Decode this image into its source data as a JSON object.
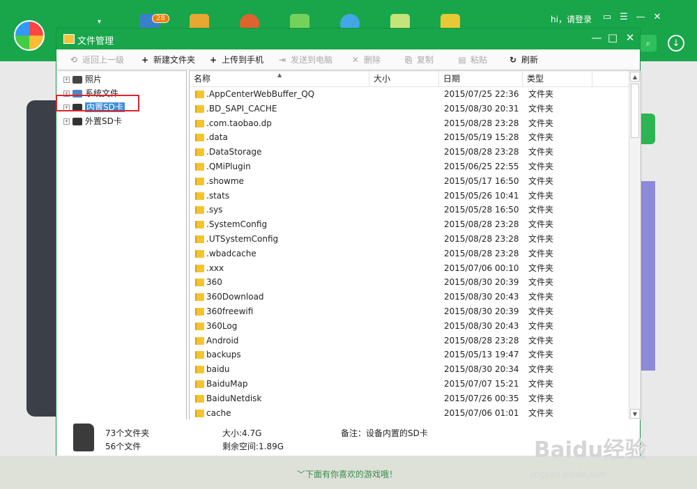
{
  "header": {
    "badge": "28",
    "greeting": "hi，请登录",
    "drop_glyph": "▾",
    "icons": [
      "chat-icon",
      "list-icon",
      "minimize-icon",
      "close-icon"
    ]
  },
  "window": {
    "title": "文件管理",
    "controls": {
      "minimize": "—",
      "maximize": "□",
      "close": "✕"
    }
  },
  "toolbar": [
    {
      "label": "返回上一级",
      "icon": "⟲",
      "disabled": true
    },
    {
      "label": "新建文件夹",
      "icon": "+",
      "disabled": false
    },
    {
      "label": "上传到手机",
      "icon": "+",
      "disabled": false
    },
    {
      "label": "发送到电脑",
      "icon": "⇥",
      "disabled": true
    },
    {
      "label": "删除",
      "icon": "✕",
      "disabled": true
    },
    {
      "label": "复制",
      "icon": "⎘",
      "disabled": true
    },
    {
      "label": "粘贴",
      "icon": "▤",
      "disabled": true
    },
    {
      "label": "刷新",
      "icon": "↻",
      "disabled": false
    }
  ],
  "tree": [
    {
      "label": "照片",
      "icon": "camera-icon"
    },
    {
      "label": "系统文件",
      "icon": "phone-icon"
    },
    {
      "label": "内置SD卡",
      "icon": "sd-card-icon",
      "selected": true
    },
    {
      "label": "外置SD卡",
      "icon": "sd-card-icon"
    }
  ],
  "columns": {
    "name": "名称",
    "size": "大小",
    "date": "日期",
    "type": "类型"
  },
  "files": [
    {
      "name": ".AppCenterWebBuffer_QQ",
      "date": "2015/07/25 22:36",
      "type": "文件夹"
    },
    {
      "name": ".BD_SAPI_CACHE",
      "date": "2015/08/30 20:31",
      "type": "文件夹"
    },
    {
      "name": ".com.taobao.dp",
      "date": "2015/08/28 23:28",
      "type": "文件夹"
    },
    {
      "name": ".data",
      "date": "2015/05/19 15:28",
      "type": "文件夹"
    },
    {
      "name": ".DataStorage",
      "date": "2015/08/28 23:28",
      "type": "文件夹"
    },
    {
      "name": ".QMiPlugin",
      "date": "2015/06/25 22:55",
      "type": "文件夹"
    },
    {
      "name": ".showme",
      "date": "2015/05/17 16:50",
      "type": "文件夹"
    },
    {
      "name": ".stats",
      "date": "2015/05/26 10:41",
      "type": "文件夹"
    },
    {
      "name": ".sys",
      "date": "2015/05/28 16:50",
      "type": "文件夹"
    },
    {
      "name": ".SystemConfig",
      "date": "2015/08/28 23:28",
      "type": "文件夹"
    },
    {
      "name": ".UTSystemConfig",
      "date": "2015/08/28 23:28",
      "type": "文件夹"
    },
    {
      "name": ".wbadcache",
      "date": "2015/08/28 23:28",
      "type": "文件夹"
    },
    {
      "name": ".xxx",
      "date": "2015/07/06 00:10",
      "type": "文件夹"
    },
    {
      "name": "360",
      "date": "2015/08/30 20:39",
      "type": "文件夹"
    },
    {
      "name": "360Download",
      "date": "2015/08/30 20:43",
      "type": "文件夹"
    },
    {
      "name": "360freewifi",
      "date": "2015/08/30 20:39",
      "type": "文件夹"
    },
    {
      "name": "360Log",
      "date": "2015/08/30 20:43",
      "type": "文件夹"
    },
    {
      "name": "Android",
      "date": "2015/08/28 23:28",
      "type": "文件夹"
    },
    {
      "name": "backups",
      "date": "2015/05/13 19:47",
      "type": "文件夹"
    },
    {
      "name": "baidu",
      "date": "2015/08/30 20:34",
      "type": "文件夹"
    },
    {
      "name": "BaiduMap",
      "date": "2015/07/07 15:21",
      "type": "文件夹"
    },
    {
      "name": "BaiduNetdisk",
      "date": "2015/07/26 00:35",
      "type": "文件夹"
    },
    {
      "name": "cache",
      "date": "2015/07/06 01:01",
      "type": "文件夹"
    }
  ],
  "status": {
    "folders": "73个文件夹",
    "files": "56个文件",
    "size": "大小:4.7G",
    "free": "剩余空间:1.89G",
    "note": "备注：设备内置的SD卡"
  },
  "footer_link": "下面有你喜欢的游戏哦！",
  "watermark": {
    "logo": "Baidu经验",
    "url": "jingyan.baidu.com"
  },
  "colors": {
    "brand_green": "#19a64a",
    "selection": "#3f8fd9",
    "highlight_box": "#d9252b",
    "folder": "#f4c430"
  }
}
